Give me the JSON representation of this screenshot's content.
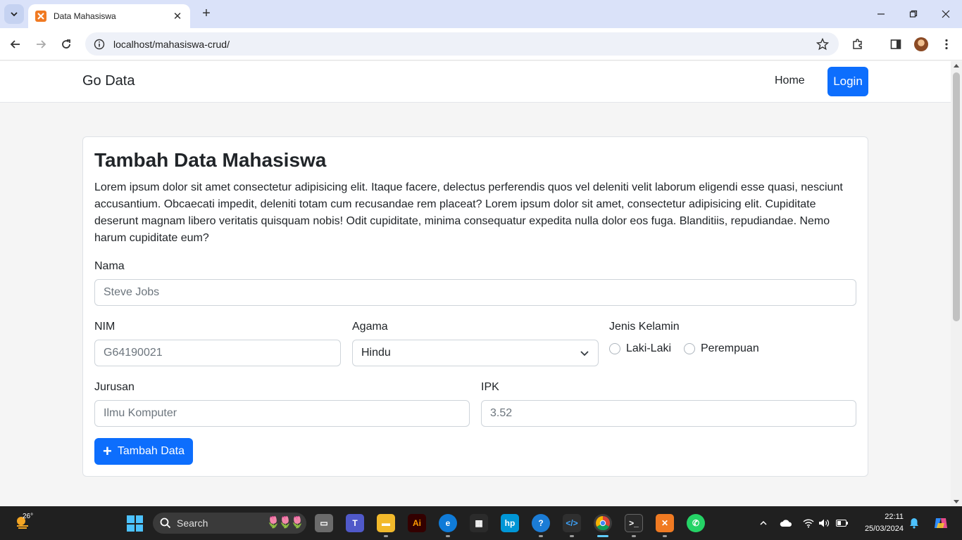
{
  "browser": {
    "tab_title": "Data Mahasiswa",
    "url": "localhost/mahasiswa-crud/"
  },
  "navbar": {
    "brand": "Go Data",
    "home_label": "Home",
    "login_label": "Login"
  },
  "form": {
    "title": "Tambah Data Mahasiswa",
    "description": "Lorem ipsum dolor sit amet consectetur adipisicing elit. Itaque facere, delectus perferendis quos vel deleniti velit laborum eligendi esse quasi, nesciunt accusantium. Obcaecati impedit, deleniti totam cum recusandae rem placeat? Lorem ipsum dolor sit amet, consectetur adipisicing elit. Cupiditate deserunt magnam libero veritatis quisquam nobis! Odit cupiditate, minima consequatur expedita nulla dolor eos fuga. Blanditiis, repudiandae. Nemo harum cupiditate eum?",
    "nama_label": "Nama",
    "nama_placeholder": "Steve Jobs",
    "nim_label": "NIM",
    "nim_placeholder": "G64190021",
    "agama_label": "Agama",
    "agama_selected": "Hindu",
    "gender_label": "Jenis Kelamin",
    "gender_options": [
      "Laki-Laki",
      "Perempuan"
    ],
    "jurusan_label": "Jurusan",
    "jurusan_placeholder": "Ilmu Komputer",
    "ipk_label": "IPK",
    "ipk_placeholder": "3.52",
    "submit_label": "Tambah Data"
  },
  "taskbar": {
    "weather_temp": "26°",
    "search_label": "Search",
    "time": "22:11",
    "date": "25/03/2024"
  },
  "colors": {
    "primary": "#0d6efd",
    "taskbar_bg": "#202020",
    "tabbar_bg": "#dae2f9"
  }
}
